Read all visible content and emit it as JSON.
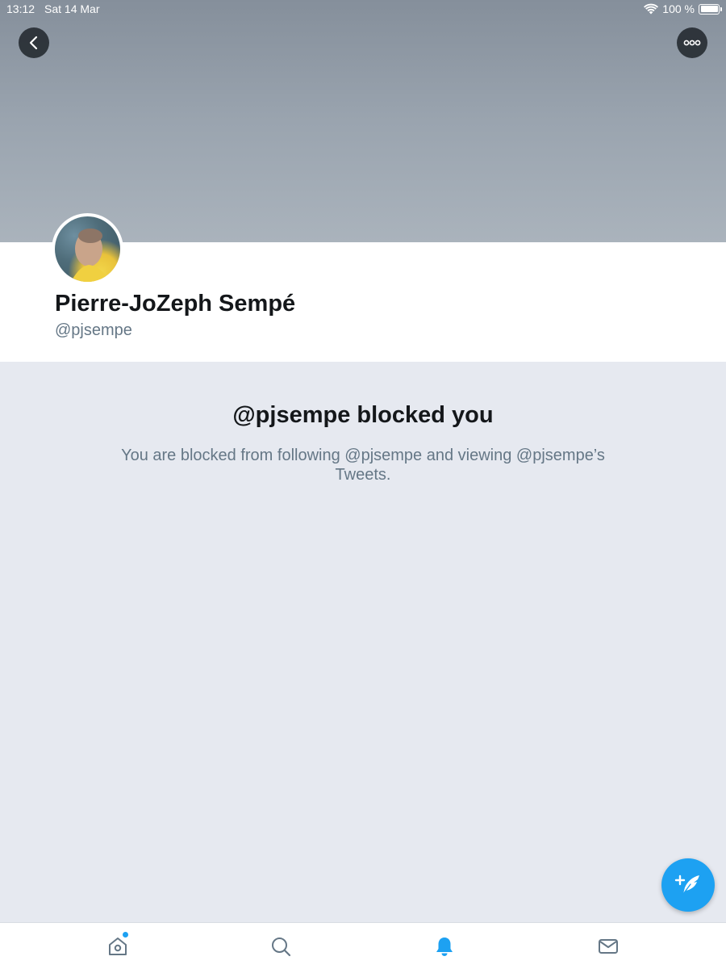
{
  "status_bar": {
    "time": "13:12",
    "date": "Sat 14 Mar",
    "battery": "100 %",
    "wifi_icon": "wifi-icon",
    "battery_icon": "battery-icon"
  },
  "header": {
    "back_icon": "chevron-left-icon",
    "more_icon": "more-horizontal-icon"
  },
  "profile": {
    "name": "Pierre-JoZeph Sempé",
    "handle": "@pjsempe"
  },
  "blocked": {
    "title": "@pjsempe blocked you",
    "description": "You are blocked from following @pjsempe and viewing @pjsempe’s Tweets."
  },
  "tab_bar": {
    "items": [
      {
        "icon": "home-icon",
        "active": false,
        "has_dot": true
      },
      {
        "icon": "search-icon",
        "active": false
      },
      {
        "icon": "bell-icon",
        "active": true
      },
      {
        "icon": "mail-icon",
        "active": false
      }
    ]
  },
  "colors": {
    "accent": "#1da1f2",
    "text_primary": "#14171a",
    "text_secondary": "#657786",
    "background": "#e6e9f0",
    "icon_inactive": "#657786"
  }
}
